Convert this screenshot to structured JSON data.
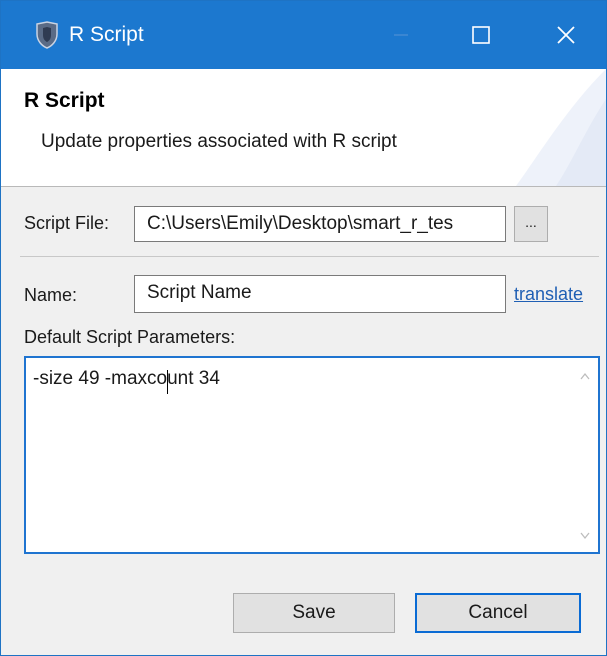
{
  "window": {
    "title": "R Script",
    "controls": [
      "minimize-icon",
      "maximize-icon",
      "close-icon"
    ]
  },
  "banner": {
    "heading": "R Script",
    "description": "Update properties associated with R script"
  },
  "form": {
    "script_file_label": "Script File:",
    "script_file_value": "C:\\Users\\Emily\\Desktop\\smart_r_tes",
    "browse_label": "...",
    "name_label": "Name:",
    "name_value": "Script Name",
    "translate_link": "translate",
    "params_label": "Default Script Parameters:",
    "params_value": "-size 49 -maxcount 34"
  },
  "buttons": {
    "save": "Save",
    "cancel": "Cancel"
  },
  "colors": {
    "titlebar": "#1c78cf",
    "focus_border": "#1f74d0",
    "link": "#1f5fb4"
  }
}
